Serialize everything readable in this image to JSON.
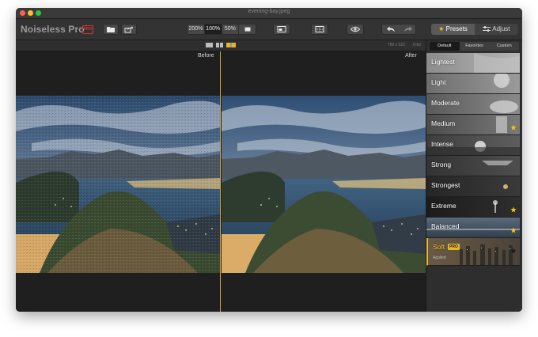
{
  "window": {
    "title": "evening-bay.jpeg"
  },
  "toolbar": {
    "app_name": "Noiseless Pro",
    "pro_badge": "PRO",
    "zoom_levels": [
      "200%",
      "100%",
      "50%"
    ],
    "zoom_selected": "100%",
    "presets_tab": "Presets",
    "adjust_tab": "Adjust"
  },
  "subbar": {
    "dimensions": "786 x 522",
    "bit_depth": "8-bit"
  },
  "canvas": {
    "before_label": "Before",
    "after_label": "After"
  },
  "panel": {
    "tabs": [
      "Default",
      "Favorites",
      "Custom"
    ],
    "active_tab": "Default",
    "presets": [
      {
        "label": "Lightest",
        "favorite": false
      },
      {
        "label": "Light",
        "favorite": false
      },
      {
        "label": "Moderate",
        "favorite": false
      },
      {
        "label": "Medium",
        "favorite": true
      },
      {
        "label": "Intense",
        "favorite": false
      },
      {
        "label": "Strong",
        "favorite": false
      },
      {
        "label": "Strongest",
        "favorite": false
      },
      {
        "label": "Extreme",
        "favorite": true
      },
      {
        "label": "Balanced",
        "favorite": true
      },
      {
        "label": "Soft",
        "favorite": true,
        "pro": "PRO",
        "sublabel": "Applied"
      }
    ]
  },
  "colors": {
    "accent": "#e5b52c",
    "divider": "#d9a53a",
    "pro_red": "#d2382e"
  }
}
